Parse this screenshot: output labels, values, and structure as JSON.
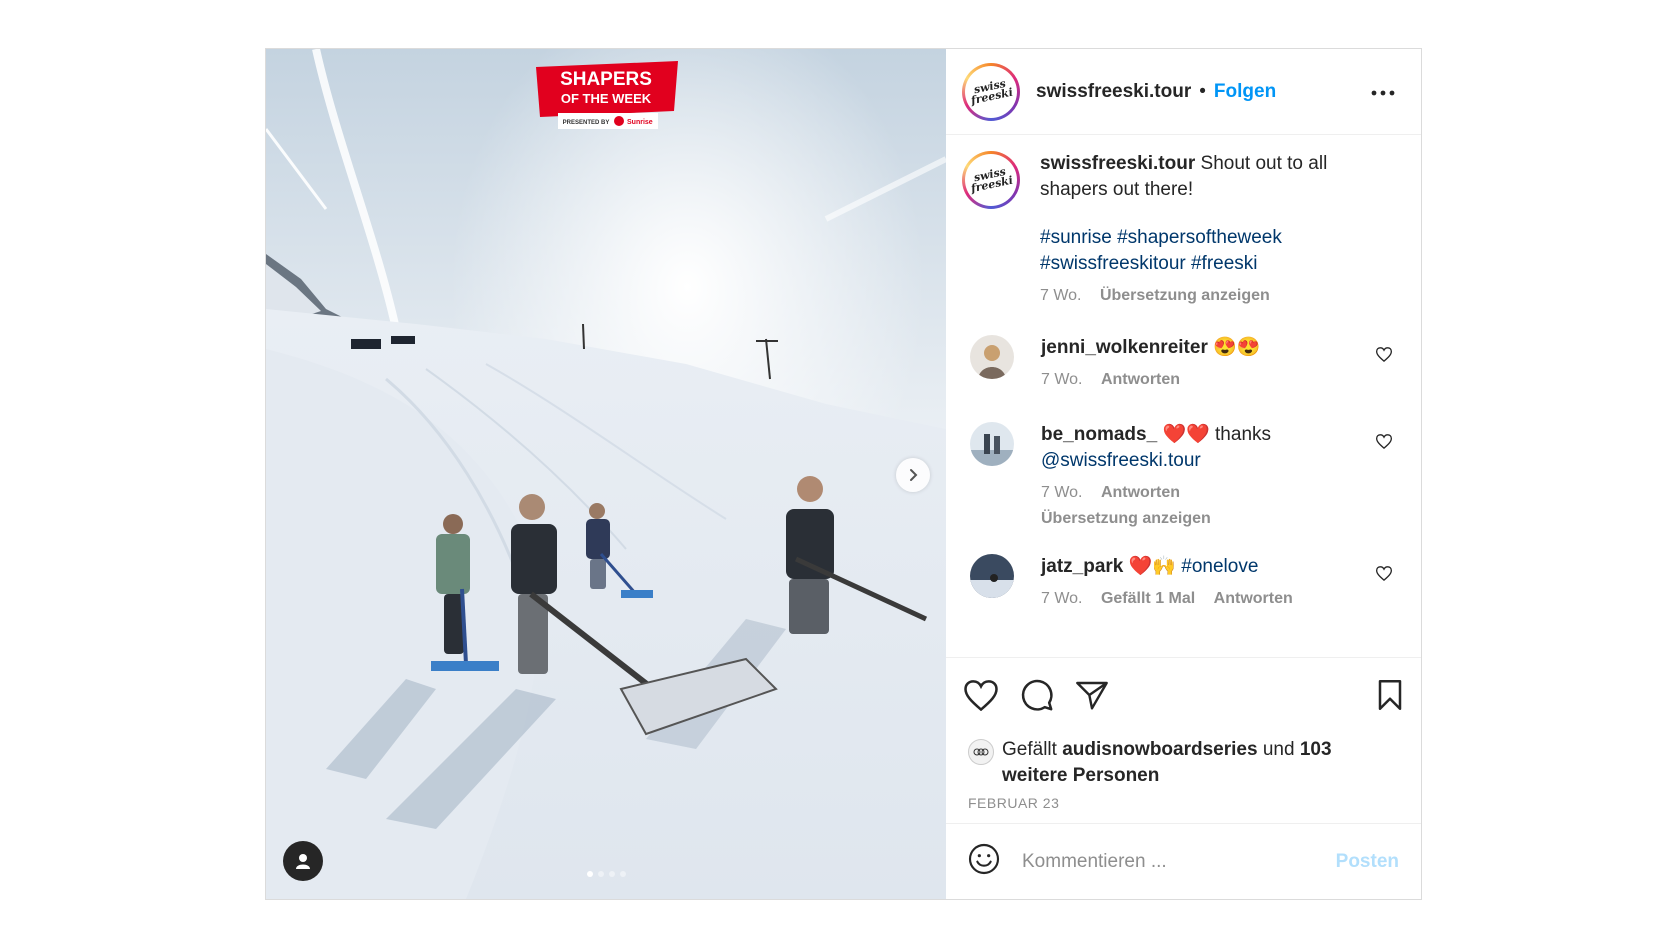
{
  "badge": {
    "line1": "SHAPERS",
    "line2": "OF THE WEEK",
    "presented_by": "PRESENTED BY",
    "sponsor": "Sunrise",
    "color": "#e1001e"
  },
  "header": {
    "username": "swissfreeski.tour",
    "separator": "•",
    "follow_label": "Folgen",
    "avatar_logo_text": "swiss freeski"
  },
  "caption": {
    "username": "swissfreeski.tour",
    "text": "Shout out to all shapers out there!",
    "hashtags_line1": "#sunrise #shapersoftheweek",
    "hashtags_line2": "#swissfreeskitour #freeski",
    "time": "7 Wo.",
    "translate_label": "Übersetzung anzeigen"
  },
  "comments": [
    {
      "username": "jenni_wolkenreiter",
      "text": "😍😍",
      "time": "7 Wo.",
      "reply_label": "Antworten"
    },
    {
      "username": "be_nomads_",
      "text": "❤️❤️ thanks",
      "mention": "@swissfreeski.tour",
      "time": "7 Wo.",
      "reply_label": "Antworten",
      "translate_label": "Übersetzung anzeigen"
    },
    {
      "username": "jatz_park",
      "text": "❤️🙌",
      "hashtag": "#onelove",
      "time": "7 Wo.",
      "likes_label": "Gefällt 1 Mal",
      "reply_label": "Antworten"
    }
  ],
  "likes": {
    "prefix": "Gefällt",
    "liker": "audisnowboardseries",
    "connector": "und",
    "count": "103",
    "suffix": "weitere Personen"
  },
  "date": "FEBRUAR 23",
  "composer": {
    "placeholder": "Kommentieren ...",
    "post_label": "Posten"
  },
  "carousel": {
    "slide_count": 4,
    "active_index": 0
  },
  "colors": {
    "link": "#0095f6",
    "hashtag": "#00376b",
    "muted": "#8e8e8e"
  }
}
